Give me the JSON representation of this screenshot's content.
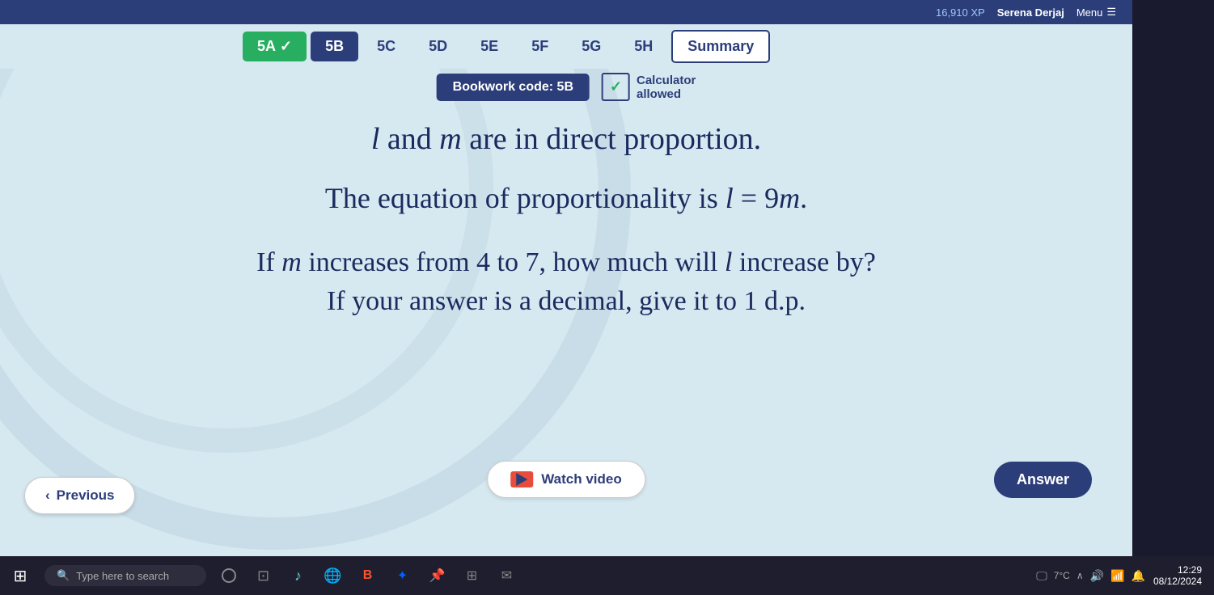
{
  "topbar": {
    "xp": "16,910 XP",
    "user": "Serena Derjaj",
    "menu_label": "Menu"
  },
  "nav": {
    "tabs": [
      {
        "id": "5A",
        "label": "5A",
        "state": "completed"
      },
      {
        "id": "5B",
        "label": "5B",
        "state": "active"
      },
      {
        "id": "5C",
        "label": "5C",
        "state": "normal"
      },
      {
        "id": "5D",
        "label": "5D",
        "state": "normal"
      },
      {
        "id": "5E",
        "label": "5E",
        "state": "normal"
      },
      {
        "id": "5F",
        "label": "5F",
        "state": "normal"
      },
      {
        "id": "5G",
        "label": "5G",
        "state": "normal"
      },
      {
        "id": "5H",
        "label": "5H",
        "state": "normal"
      },
      {
        "id": "summary",
        "label": "Summary",
        "state": "summary"
      }
    ]
  },
  "bookwork": {
    "label": "Bookwork code: 5B"
  },
  "calculator": {
    "label": "Calculator",
    "sublabel": "allowed"
  },
  "question": {
    "line1": "l and m are in direct proportion.",
    "line2": "The equation of proportionality is l = 9m.",
    "line3": "If m increases from 4 to 7, how much will l increase by?",
    "line4": "If your answer is a decimal, give it to 1 d.p."
  },
  "buttons": {
    "answer": "Answer",
    "watch_video": "Watch video",
    "previous": "Previous"
  },
  "taskbar": {
    "search_placeholder": "Type here to search",
    "time": "12:29",
    "date": "08/12/2024",
    "temperature": "7°C"
  }
}
